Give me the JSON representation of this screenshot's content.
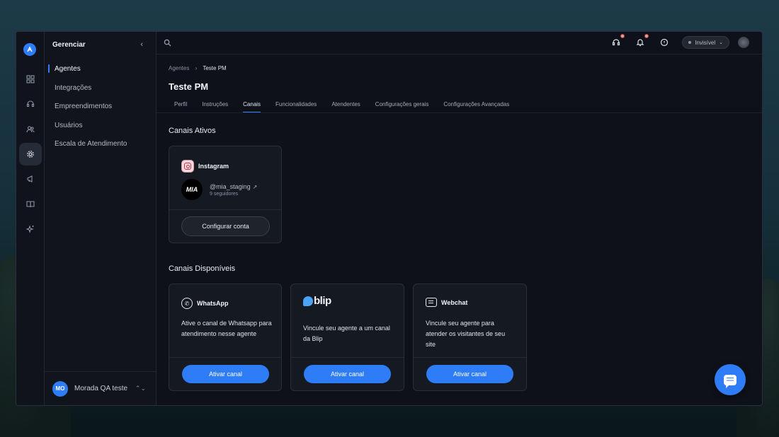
{
  "sidebar": {
    "title": "Gerenciar",
    "collapse_icon": "chevron-left-icon",
    "items": [
      {
        "label": "Agentes",
        "active": true
      },
      {
        "label": "Integrações"
      },
      {
        "label": "Empreendimentos"
      },
      {
        "label": "Usuários"
      },
      {
        "label": "Escala de Atendimento"
      }
    ],
    "user": {
      "initials": "MO",
      "name": "Morada QA teste"
    }
  },
  "rail": {
    "icons": [
      "logo-icon",
      "grid-icon",
      "headset-icon",
      "users-icon",
      "settings-icon",
      "megaphone-icon",
      "book-icon",
      "sparkles-icon"
    ],
    "active": "settings-icon"
  },
  "topbar": {
    "status": "Invisível",
    "icons": [
      "search-icon",
      "headset-icon",
      "bell-icon",
      "help-icon",
      "avatar"
    ]
  },
  "content": {
    "breadcrumb": {
      "parent": "Agentes",
      "current": "Teste PM"
    },
    "title": "Teste PM",
    "tabs": [
      {
        "label": "Perfil"
      },
      {
        "label": "Instruções"
      },
      {
        "label": "Canais",
        "active": true
      },
      {
        "label": "Funcionalidades"
      },
      {
        "label": "Atendentes"
      },
      {
        "label": "Configurações gerais"
      },
      {
        "label": "Configurações Avançadas"
      }
    ],
    "active_section": {
      "title": "Canais Ativos",
      "instagram": {
        "name": "Instagram",
        "avatar_text": "MIA",
        "handle": "@mia_staging",
        "followers": "9 seguidores",
        "button": "Configurar conta"
      }
    },
    "available_section": {
      "title": "Canais Disponíveis",
      "channels": [
        {
          "name": "WhatsApp",
          "desc": "Ative o canal de Whatsapp para atendimento nesse agente",
          "button": "Ativar canal"
        },
        {
          "name": "blip",
          "desc": "Vincule seu agente a um canal da Blip",
          "button": "Ativar canal"
        },
        {
          "name": "Webchat",
          "desc": "Vincule seu agente para atender os visitantes de seu site",
          "button": "Ativar canal"
        }
      ]
    }
  },
  "colors": {
    "accent": "#2f7df6",
    "background": "#0e1119",
    "card": "#151922"
  }
}
